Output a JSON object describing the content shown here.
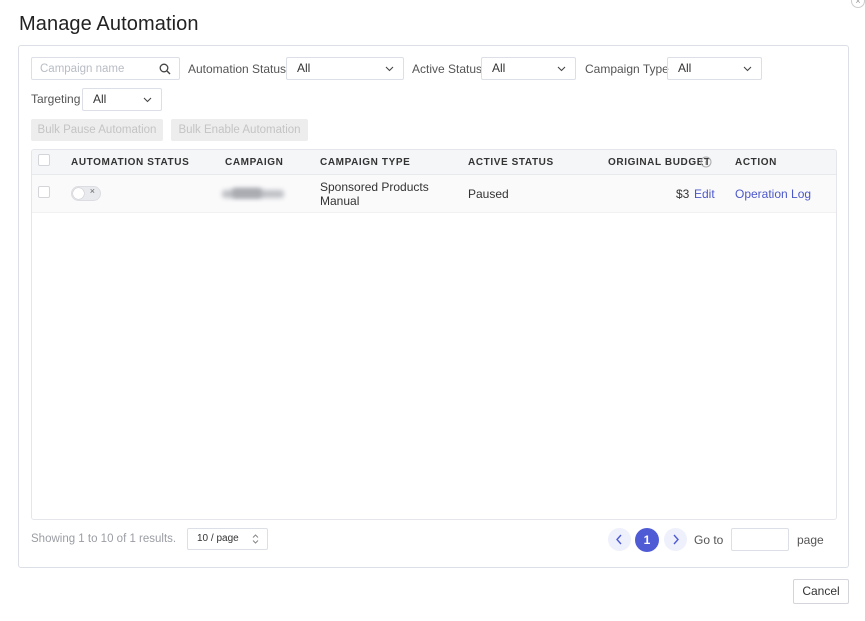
{
  "dialog": {
    "title": "Manage Automation",
    "close_glyph": "×"
  },
  "filters": {
    "search_placeholder": "Campaign name",
    "automation_status_label": "Automation Status",
    "automation_status_value": "All",
    "active_status_label": "Active Status",
    "active_status_value": "All",
    "campaign_type_label": "Campaign Type",
    "campaign_type_value": "All",
    "targeting_label": "Targeting",
    "targeting_value": "All"
  },
  "bulk_actions": {
    "pause_label": "Bulk Pause Automation",
    "enable_label": "Bulk Enable Automation"
  },
  "table": {
    "columns": {
      "automation_status": "AUTOMATION STATUS",
      "campaign": "CAMPAIGN",
      "campaign_type": "CAMPAIGN TYPE",
      "active_status": "ACTIVE STATUS",
      "original_budget": "ORIGINAL BUDGET",
      "action": "ACTION"
    },
    "rows": [
      {
        "automation_toggle_glyph": "×",
        "campaign_type_line1": "Sponsored Products",
        "campaign_type_line2": "Manual",
        "active_status": "Paused",
        "budget": "$3",
        "edit_label": "Edit",
        "action_label": "Operation Log"
      }
    ]
  },
  "pagination": {
    "summary": "Showing 1 to 10 of 1 results.",
    "page_size": "10 / page",
    "current_page": "1",
    "goto_label": "Go to",
    "page_label": "page"
  },
  "footer": {
    "cancel_label": "Cancel"
  },
  "colors": {
    "accent": "#4f5bd5",
    "link": "#4b57c9"
  }
}
